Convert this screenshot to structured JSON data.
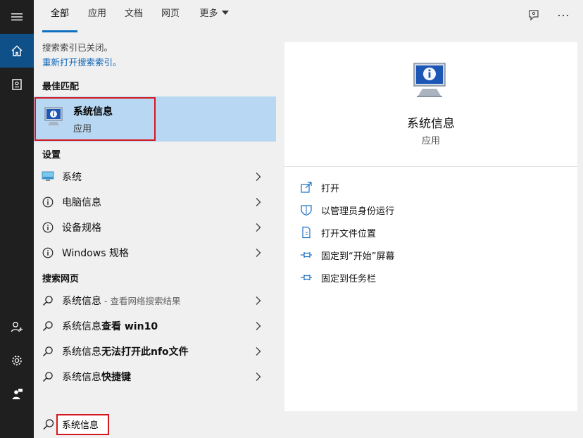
{
  "tabs": [
    {
      "label": "全部"
    },
    {
      "label": "应用"
    },
    {
      "label": "文档"
    },
    {
      "label": "网页"
    },
    {
      "label": "更多"
    }
  ],
  "notice": {
    "text": "搜索索引已关闭。",
    "link": "重新打开搜索索引。"
  },
  "best_match": {
    "header": "最佳匹配",
    "title": "系统信息",
    "subtitle": "应用"
  },
  "settings": {
    "header": "设置",
    "items": [
      {
        "label": "系统",
        "icon": "monitor-icon"
      },
      {
        "label": "电脑信息",
        "icon": "info-icon"
      },
      {
        "label": "设备规格",
        "icon": "info-icon"
      },
      {
        "label": "Windows 规格",
        "icon": "info-icon"
      }
    ]
  },
  "web": {
    "header": "搜索网页",
    "items": [
      {
        "prefix": "系统信息",
        "bold": "",
        "hint": " - 查看网络搜索结果"
      },
      {
        "prefix": "系统信息",
        "bold": "查看 win10",
        "hint": ""
      },
      {
        "prefix": "系统信息",
        "bold": "无法打开此nfo文件",
        "hint": ""
      },
      {
        "prefix": "系统信息",
        "bold": "快捷键",
        "hint": ""
      }
    ]
  },
  "preview": {
    "title": "系统信息",
    "subtitle": "应用",
    "actions": [
      {
        "label": "打开",
        "icon": "open-icon"
      },
      {
        "label": "以管理员身份运行",
        "icon": "shield-icon"
      },
      {
        "label": "打开文件位置",
        "icon": "file-location-icon"
      },
      {
        "label": "固定到“开始”屏幕",
        "icon": "pin-icon"
      },
      {
        "label": "固定到任务栏",
        "icon": "pin-icon"
      }
    ]
  },
  "search": {
    "value": "系统信息"
  },
  "colors": {
    "accent": "#0e6fbf",
    "highlight": "#b7d7f2",
    "annotation_red": "#d3191f",
    "rail": "#1f1f1f"
  }
}
